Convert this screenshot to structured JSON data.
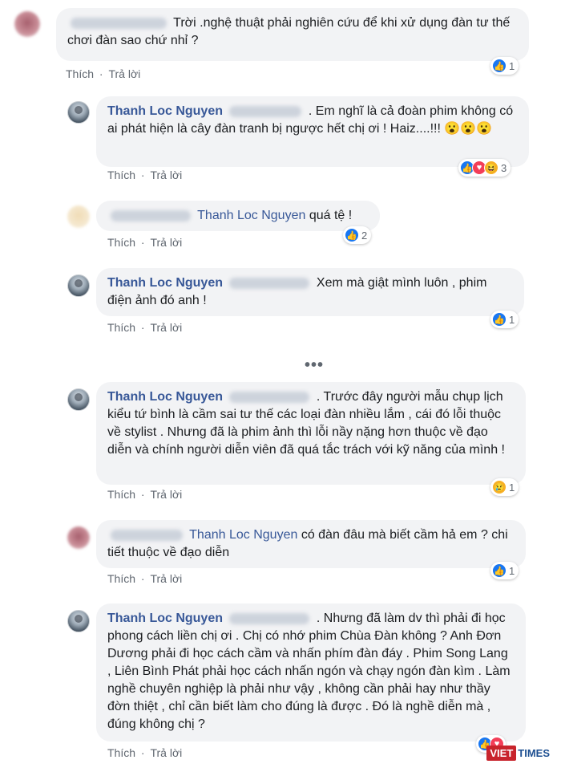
{
  "comments": [
    {
      "author": "",
      "text": "Trời .nghệ thuật phải nghiên cứu để khi xử dụng đàn tư thế chơi đàn sao chứ nhỉ ?",
      "actions": {
        "like": "Thích",
        "reply": "Trả lời"
      },
      "reactions": {
        "icons": [
          "like-icon"
        ],
        "count": "1"
      }
    },
    {
      "author": "Thanh Loc Nguyen",
      "text": ". Em nghĩ là cả đoàn phim không có ai phát hiện là cây đàn tranh bị ngược hết chị ơi ! Haiz....!!! 😮😮😮",
      "actions": {
        "like": "Thích",
        "reply": "Trả lời"
      },
      "reactions": {
        "icons": [
          "like-icon",
          "love-icon",
          "haha-icon"
        ],
        "count": "3"
      }
    },
    {
      "author": "",
      "tag": "Thanh Loc Nguyen",
      "text": "quá tệ !",
      "actions": {
        "like": "Thích",
        "reply": "Trả lời"
      },
      "reactions": {
        "icons": [
          "like-icon"
        ],
        "count": "2"
      }
    },
    {
      "author": "Thanh Loc Nguyen",
      "text": "Xem mà giật mình luôn , phim điện ảnh đó anh !",
      "actions": {
        "like": "Thích",
        "reply": "Trả lời"
      },
      "reactions": {
        "icons": [
          "like-icon"
        ],
        "count": "1"
      }
    },
    {
      "author": "Thanh Loc Nguyen",
      "text": ". Trước đây người mẫu chụp lịch kiểu tứ bình là cầm sai tư thế các loại đàn nhiều lắm , cái đó lỗi thuộc về stylist . Nhưng đã là phim ảnh thì lỗi nầy nặng hơn thuộc về đạo diễn và chính người diễn viên đã quá tắc trách với kỹ năng của mình !",
      "actions": {
        "like": "Thích",
        "reply": "Trả lời"
      },
      "reactions": {
        "icons": [
          "sad-icon"
        ],
        "count": "1"
      }
    },
    {
      "author": "",
      "tag": "Thanh Loc Nguyen",
      "text": "có đàn đâu mà biết cầm hả em ? chi tiết thuộc về đạo diễn",
      "actions": {
        "like": "Thích",
        "reply": "Trả lời"
      },
      "reactions": {
        "icons": [
          "like-icon"
        ],
        "count": "1"
      }
    },
    {
      "author": "Thanh Loc Nguyen",
      "text": ". Nhưng đã làm dv thì phải đi học phong cách liền chị ơi . Chị có nhớ phim Chùa Đàn không ? Anh Đơn Dương phải đi học cách cầm và nhấn phím đàn đáy . Phim Song Lang , Liên Bình Phát phải học cách nhấn ngón và chạy ngón đàn kìm . Làm nghề chuyên nghiệp là phải như vậy , không cần phải hay như thầy đờn thiệt , chỉ cần biết làm cho đúng là được . Đó là nghề diễn mà , đúng không chị ?",
      "actions": {
        "like": "Thích",
        "reply": "Trả lời"
      },
      "reactions": {
        "icons": [
          "like-icon",
          "love-icon"
        ],
        "count": ""
      }
    }
  ],
  "more_replies": "•••",
  "watermark": {
    "box": "VIET",
    "text": "TIMES"
  }
}
